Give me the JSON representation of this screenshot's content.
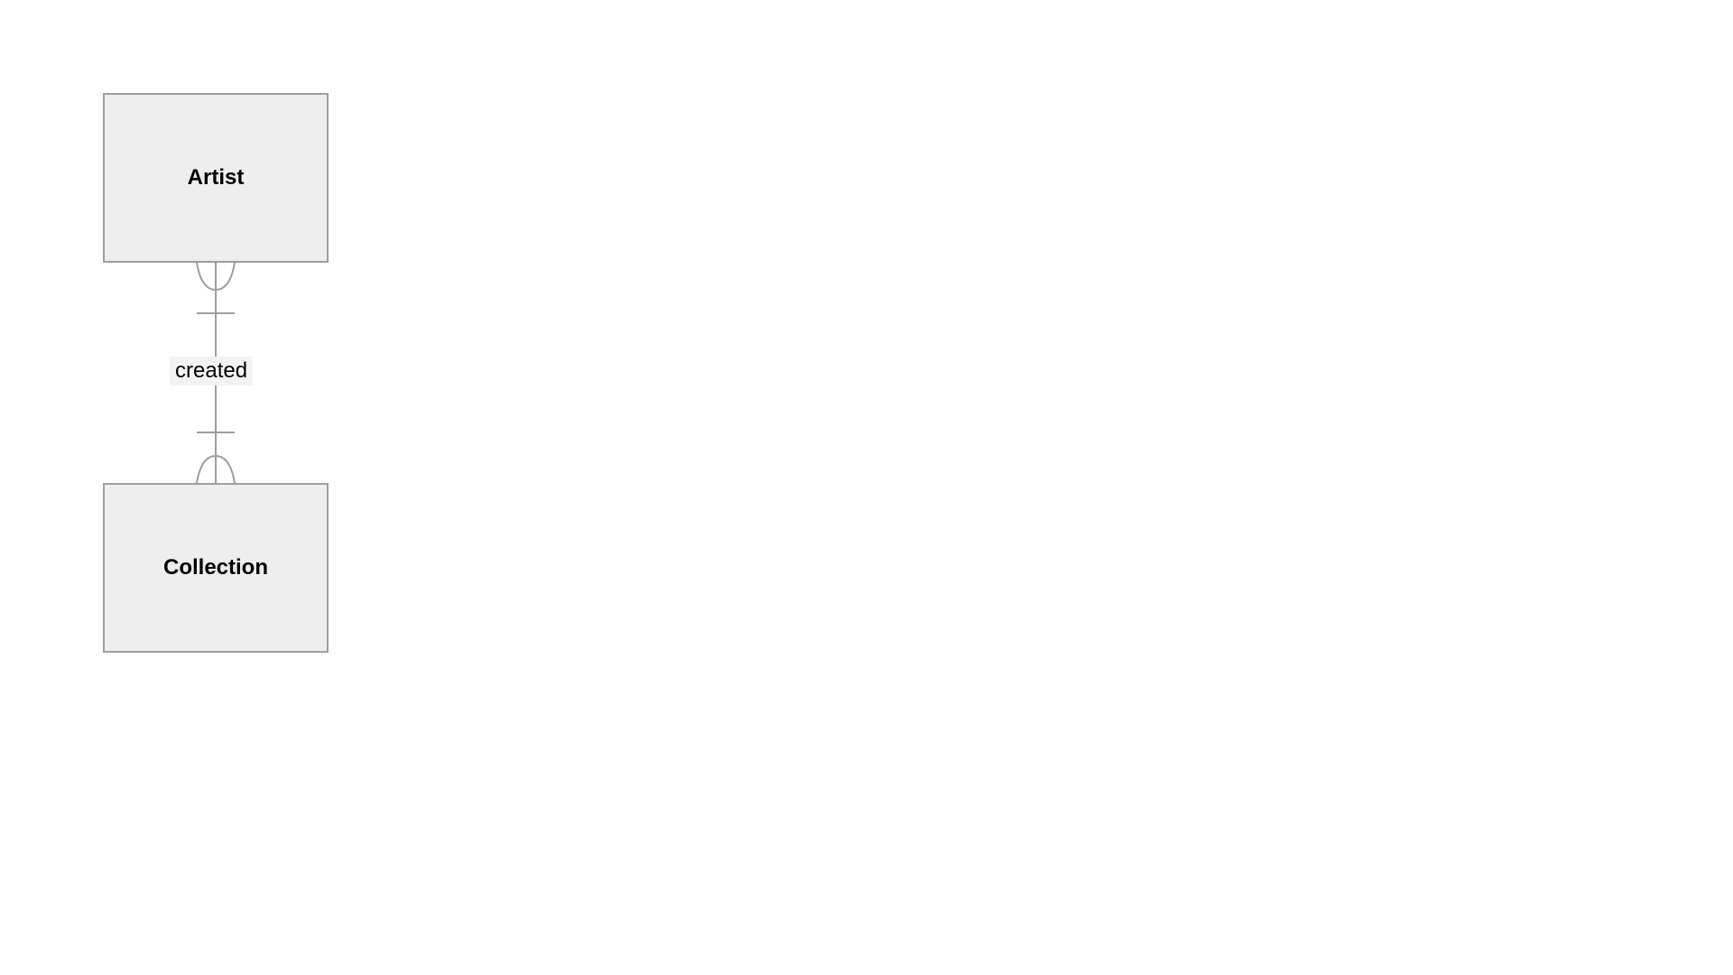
{
  "diagram": {
    "type": "entity-relationship",
    "entities": [
      {
        "id": "artist",
        "name": "Artist"
      },
      {
        "id": "collection",
        "name": "Collection"
      }
    ],
    "relationships": [
      {
        "from": "artist",
        "to": "collection",
        "label": "created",
        "from_cardinality": "one-or-many",
        "to_cardinality": "one-or-many"
      }
    ],
    "colors": {
      "entity_fill": "#eeeeee",
      "entity_stroke": "#9e9e9e",
      "connector_stroke": "#9e9e9e",
      "label_bg": "#f3f3f3"
    }
  }
}
